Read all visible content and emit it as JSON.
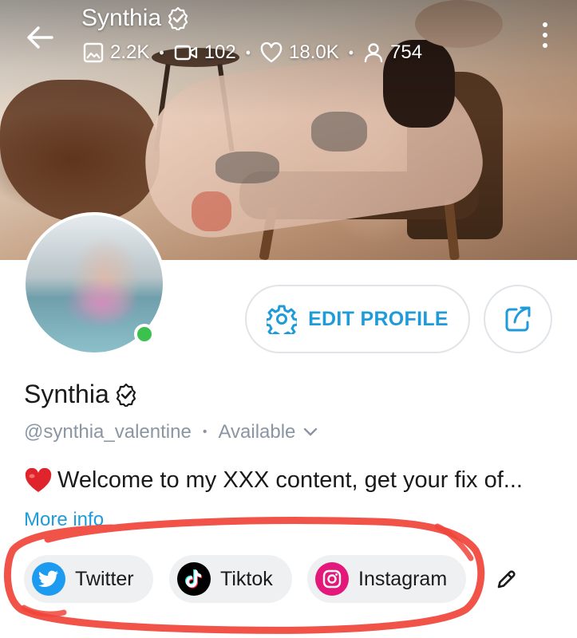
{
  "header": {
    "title": "Synthia",
    "stats": {
      "posts": "2.2K",
      "videos": "102",
      "likes": "18.0K",
      "fans": "754"
    }
  },
  "profile": {
    "name": "Synthia",
    "handle": "@synthia_valentine",
    "status": "Available",
    "bio": "Welcome to my XXX content, get your fix of...",
    "bio_emoji": "❤️",
    "more_info": "More info",
    "online": true
  },
  "actions": {
    "edit_profile": "EDIT PROFILE"
  },
  "social_links": [
    {
      "label": "Twitter",
      "icon": "twitter-icon"
    },
    {
      "label": "Tiktok",
      "icon": "tiktok-icon"
    },
    {
      "label": "Instagram",
      "icon": "instagram-icon"
    }
  ],
  "colors": {
    "accent": "#1f9bd9",
    "online": "#3cc14e",
    "annotation": "#f0443a",
    "twitter": "#1d9bf0",
    "instagram": "#e4177a"
  }
}
